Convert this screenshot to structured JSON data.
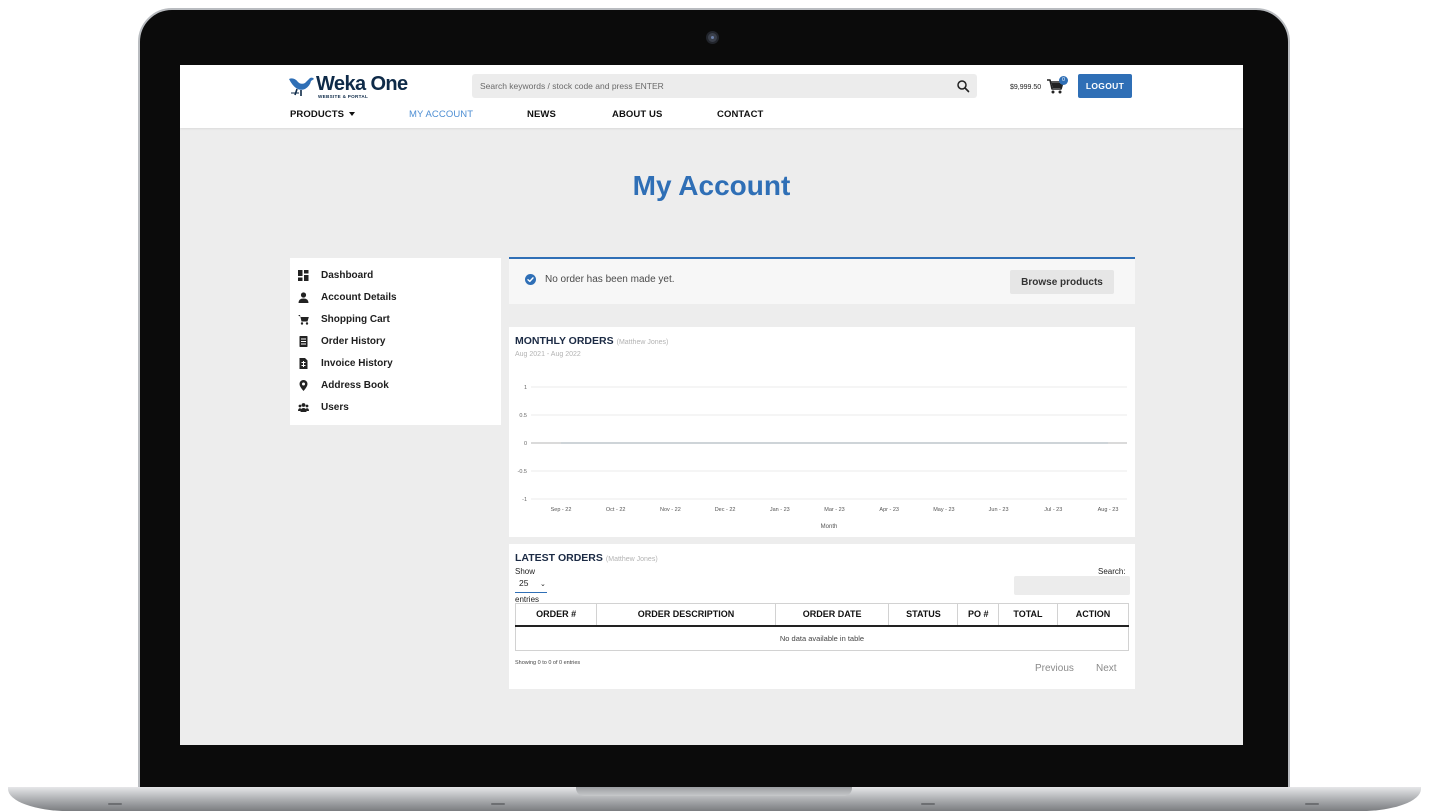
{
  "brand": {
    "name": "Weka One",
    "tagline": "WEBSITE & PORTAL",
    "accent": "#2f6fb6"
  },
  "header": {
    "search_placeholder": "Search keywords / stock code and press ENTER",
    "cart_total": "$9,999.50",
    "cart_count": "0",
    "logout_label": "LOGOUT"
  },
  "nav": {
    "products": "PRODUCTS",
    "my_account": "MY ACCOUNT",
    "news": "NEWS",
    "about": "ABOUT US",
    "contact": "CONTACT"
  },
  "page": {
    "title": "My Account"
  },
  "sidebar": {
    "items": [
      {
        "label": "Dashboard",
        "icon": "dashboard-icon"
      },
      {
        "label": "Account Details",
        "icon": "user-icon"
      },
      {
        "label": "Shopping Cart",
        "icon": "cart-icon"
      },
      {
        "label": "Order History",
        "icon": "document-icon"
      },
      {
        "label": "Invoice History",
        "icon": "invoice-icon"
      },
      {
        "label": "Address Book",
        "icon": "map-pin-icon"
      },
      {
        "label": "Users",
        "icon": "users-icon"
      }
    ]
  },
  "notice": {
    "text": "No order has been made yet.",
    "button": "Browse products"
  },
  "monthly_orders": {
    "title": "MONTHLY ORDERS",
    "user": "(Matthew Jones)",
    "range": "Aug 2021 - Aug 2022"
  },
  "chart_data": {
    "type": "line",
    "title": "MONTHLY ORDERS",
    "subtitle": "Aug 2021 - Aug 2022",
    "xlabel": "Month",
    "ylabel": "",
    "categories": [
      "Sep - 22",
      "Oct - 22",
      "Nov - 22",
      "Dec - 22",
      "Jan - 23",
      "Mar - 23",
      "Apr - 23",
      "May - 23",
      "Jun - 23",
      "Jul - 23",
      "Aug - 23"
    ],
    "y_ticks": [
      "1",
      "0.5",
      "0",
      "-0.5",
      "-1"
    ],
    "ylim": [
      -1,
      1
    ],
    "grid": true,
    "series": [
      {
        "values": [
          0,
          0,
          0,
          0,
          0,
          0,
          0,
          0,
          0,
          0,
          0
        ]
      }
    ]
  },
  "latest_orders": {
    "title": "LATEST ORDERS",
    "user": "(Matthew Jones)",
    "show_label": "Show",
    "page_size": "25",
    "entries_label": "entries",
    "search_label": "Search:",
    "columns": [
      "ORDER #",
      "ORDER DESCRIPTION",
      "ORDER DATE",
      "STATUS",
      "PO #",
      "TOTAL",
      "ACTION"
    ],
    "empty_text": "No data available in table",
    "showing_text": "Showing 0 to 0 of 0 entries",
    "previous": "Previous",
    "next": "Next"
  }
}
